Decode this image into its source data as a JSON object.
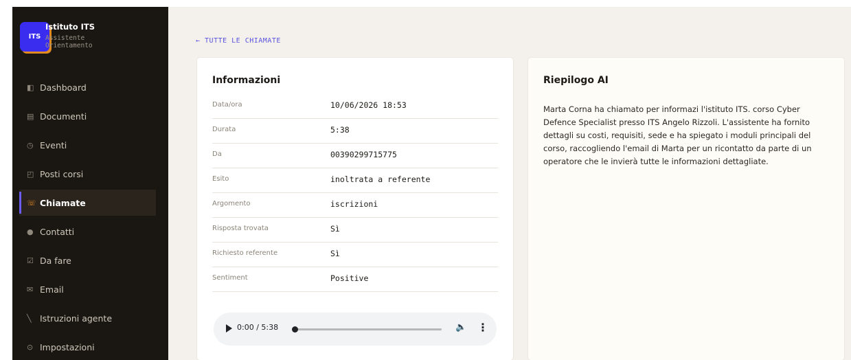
{
  "brand": {
    "logo": "ITS",
    "title": "Istituto ITS",
    "subtitle": "Assistente Orientamento"
  },
  "nav": [
    {
      "label": "Dashboard",
      "icon": "dashboard-icon",
      "glyph": "◧"
    },
    {
      "label": "Documenti",
      "icon": "documents-icon",
      "glyph": "▤"
    },
    {
      "label": "Eventi",
      "icon": "clock-icon",
      "glyph": "◷"
    },
    {
      "label": "Posti corsi",
      "icon": "seats-icon",
      "glyph": "◰"
    },
    {
      "label": "Chiamate",
      "icon": "phone-icon",
      "glyph": "☏",
      "active": true
    },
    {
      "label": "Contatti",
      "icon": "contacts-icon",
      "glyph": "●"
    },
    {
      "label": "Da fare",
      "icon": "checkbox-icon",
      "glyph": "☑"
    },
    {
      "label": "Email",
      "icon": "mail-icon",
      "glyph": "✉"
    },
    {
      "label": "Istruzioni agente",
      "icon": "pen-icon",
      "glyph": "╲"
    },
    {
      "label": "Impostazioni",
      "icon": "settings-icon",
      "glyph": "⊙"
    }
  ],
  "back_link": "← TUTTE LE CHIAMATE",
  "info": {
    "title": "Informazioni",
    "rows": [
      {
        "label": "Data/ora",
        "value": "10/06/2026 18:53"
      },
      {
        "label": "Durata",
        "value": "5:38"
      },
      {
        "label": "Da",
        "value": "00390299715775"
      },
      {
        "label": "Esito",
        "value": "inoltrata a referente"
      },
      {
        "label": "Argomento",
        "value": "iscrizioni"
      },
      {
        "label": "Risposta trovata",
        "value": "Sì"
      },
      {
        "label": "Richiesto referente",
        "value": "Sì"
      },
      {
        "label": "Sentiment",
        "value": "Positive"
      }
    ],
    "audio": {
      "time": "0:00 / 5:38",
      "progress": 0
    }
  },
  "summary": {
    "title": "Riepilogo AI",
    "text": "Marta Corna ha chiamato per informazi l'istituto ITS. corso Cyber Defence Specialist presso ITS Angelo Rizzoli. L'assistente ha fornito dettagli su costi, requisiti, sede e ha spiegato i moduli principali del corso, raccogliendo l'email di Marta per un ricontatto da parte di un operatore che le invierà tutte le informazioni dettagliate."
  },
  "colors": {
    "sidebar_bg": "#1a1612",
    "accent_orange": "#e08a1f",
    "accent_purple": "#5a52e0",
    "main_bg": "#f4f1ec"
  }
}
